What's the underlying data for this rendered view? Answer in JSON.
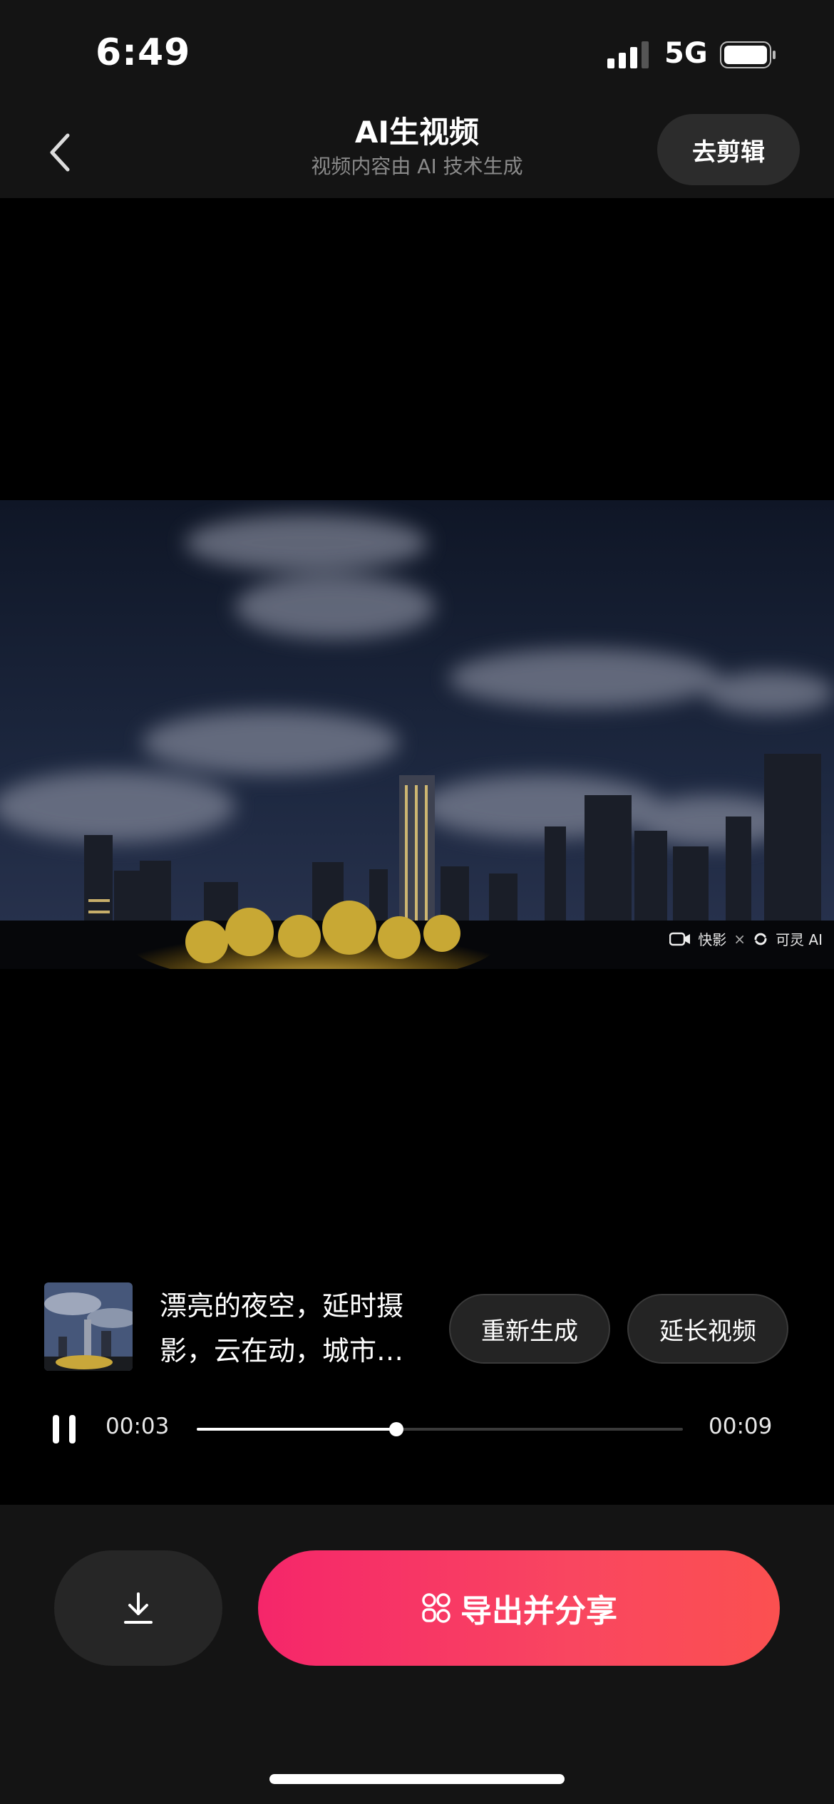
{
  "status_bar": {
    "time": "6:49",
    "network": "5G"
  },
  "header": {
    "back_icon": "chevron-left-icon",
    "title": "AI生视频",
    "subtitle": "视频内容由 AI 技术生成",
    "edit_button": "去剪辑"
  },
  "video": {
    "watermark_app": "快影",
    "watermark_separator": "×",
    "watermark_ai": "可灵 AI"
  },
  "prompt": {
    "text": "漂亮的夜空，延时摄影，云在动，城市夜景",
    "regenerate_button": "重新生成",
    "extend_button": "延长视频"
  },
  "playback": {
    "state_icon": "pause-icon",
    "current_time": "00:03",
    "total_time": "00:09",
    "progress": 0.41
  },
  "actions": {
    "download_icon": "download-icon",
    "export_icon": "share-people-icon",
    "export_button": "导出并分享"
  },
  "colors": {
    "accent_start": "#f5266a",
    "accent_end": "#fb5050",
    "background": "#000000",
    "panel": "#141414"
  }
}
